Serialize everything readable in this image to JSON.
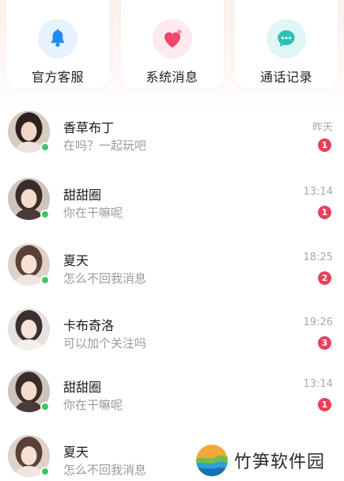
{
  "quick_actions": [
    {
      "label": "官方客服",
      "icon": "bell-icon",
      "color": "#1e8cf0"
    },
    {
      "label": "系统消息",
      "icon": "heart-icon",
      "color": "#f2466a"
    },
    {
      "label": "通话记录",
      "icon": "chat-bubble-icon",
      "color": "#28c2b8"
    }
  ],
  "conversations": [
    {
      "name": "香草布丁",
      "message": "在吗？一起玩吧",
      "time": "昨天",
      "unread": "1",
      "online": true
    },
    {
      "name": "甜甜圈",
      "message": "你在干嘛呢",
      "time": "13:14",
      "unread": "1",
      "online": true
    },
    {
      "name": "夏天",
      "message": "怎么不回我消息",
      "time": "18:25",
      "unread": "2",
      "online": true
    },
    {
      "name": "卡布奇洛",
      "message": "可以加个关注吗",
      "time": "19:26",
      "unread": "3",
      "online": false
    },
    {
      "name": "甜甜圈",
      "message": "你在干嘛呢",
      "time": "13:14",
      "unread": "1",
      "online": true
    },
    {
      "name": "夏天",
      "message": "怎么不回我消息",
      "time": "",
      "unread": "",
      "online": true
    }
  ],
  "watermark": {
    "text": "竹笋软件园"
  },
  "colors": {
    "badge": "#e8405a",
    "online": "#3cc66a"
  }
}
